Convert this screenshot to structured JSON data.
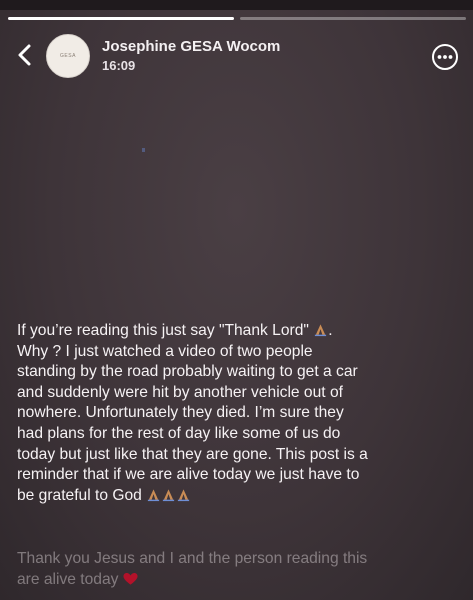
{
  "story": {
    "progress": [
      1.0,
      0.0
    ],
    "poster_name": "Josephine GESA Wocom",
    "time": "16:09",
    "avatar_label": "GESA",
    "body_line1": "If you’re reading this just say \"Thank Lord\"",
    "body_middle": "Why ? I just watched a video of two people\nstanding by the road probably waiting to get a car\nand suddenly were hit by another vehicle out of\nnowhere. Unfortunately they died. I’m sure they\nhad plans for the rest of day like some of us do\ntoday but just like that they are gone. This post is a\nreminder that if we are alive today we just have to\nbe grateful to God",
    "body_faded_line1": "Thank you Jesus and I and the person reading this",
    "body_faded_line2": "are alive today",
    "icons": {
      "back": "chevron-left-icon",
      "more": "more-options-icon",
      "pray": "praying-hands-icon",
      "heart": "heart-icon"
    },
    "colors": {
      "background": "#3e3439",
      "text": "#f6f2f4",
      "pray_emoji": "#c98c55",
      "heart": "#b3122a"
    }
  }
}
